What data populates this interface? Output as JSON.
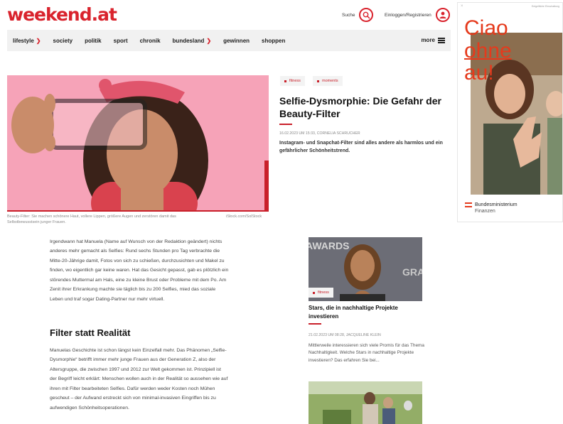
{
  "header": {
    "logo_main": "weekend",
    "logo_dot": ".at",
    "search_label": "Suche",
    "login_label": "Einloggen/Registrieren"
  },
  "nav": {
    "items": [
      {
        "label": "lifestyle",
        "dropdown": true
      },
      {
        "label": "society",
        "dropdown": false
      },
      {
        "label": "politik",
        "dropdown": false
      },
      {
        "label": "sport",
        "dropdown": false
      },
      {
        "label": "chronik",
        "dropdown": false
      },
      {
        "label": "bundesland",
        "dropdown": true
      },
      {
        "label": "gewinnen",
        "dropdown": false
      },
      {
        "label": "shoppen",
        "dropdown": false
      }
    ],
    "more_label": "more"
  },
  "article": {
    "tags": [
      "fitness",
      "moments"
    ],
    "title": "Selfie-Dysmorphie: Die Gefahr der Beauty-Filter",
    "meta": "16.02.2023 UM 15:33, CORNELIA SCHRUCHER",
    "lead": "Instagram- und Snapchat-Filter sind alles andere als harmlos und ein gefährlicher Schönheitstrend.",
    "image_caption": "Beauty-Filter: Sie machen schönere Haut, vollere Lippen, größere Augen und zerstören damit das Selbstbewusstsein junger Frauen.",
    "image_credit": "iStock.com/SolStock",
    "paragraph_1": "Irgendwann hat Manuela (Name auf Wunsch von der Redaktion geändert) nichts anderes mehr gemacht als Selfies: Rund sechs Stunden pro Tag verbrachte die Mitte-20-Jährige damit, Fotos von sich zu schießen, durchzusichten und Makel zu finden, wo eigentlich gar keine waren. Hat das Gesicht gepasst, gab es plötzlich ein störendes Muttermal am Hals, eine zu kleine Brust oder Probleme mit dem Po. Am Zenit ihrer Erkrankung machte sie täglich bis zu 200 Selfies, mied das soziale Leben und traf sogar Dating-Partner nur mehr virtuell.",
    "subheading": "Filter statt Realität",
    "paragraph_2": "Manuelas Geschichte ist schon längst kein Einzelfall mehr. Das Phänomen „Selfie-Dysmorphie“ betrifft immer mehr junge Frauen aus der Generation Z, also der Altersgruppe, die zwischen 1997 und 2012 zur Welt gekommen ist. Prinzipiell ist der Begriff leicht erklärt: Menschen wollen auch in der Realität so aussehen wie auf ihren mit Filter bearbeiteten Selfies. Dafür werden weder Kosten noch Mühen gescheut – der Aufwand erstreckt sich von minimal-invasiven Eingriffen bis zu aufwendigen Schönheitsoperationen."
  },
  "sidebar_card": {
    "image_text": "AWARDS",
    "image_text_2": "GRA",
    "tag": "fitness",
    "title": "Stars, die in nachhaltige Projekte investieren",
    "meta": "21.02.2023 UM 08:28, JACQUELINE KLEIN",
    "text": "Mittlerweile interessieren sich viele Promis für das Thema Nachhaltigkeit. Welche Stars in nachhaltige Projekte investieren? Das erfahren Sie bei..."
  },
  "ad": {
    "label": "Entgeltliche Einschaltung",
    "close": "×",
    "line1": "Ciao",
    "line2": "ohne",
    "line3": "au!",
    "ministry": "Bundesministerium",
    "ministry_sub": "Finanzen"
  },
  "colors": {
    "brand_red": "#d9232d",
    "ad_orange": "#e53a1c"
  }
}
